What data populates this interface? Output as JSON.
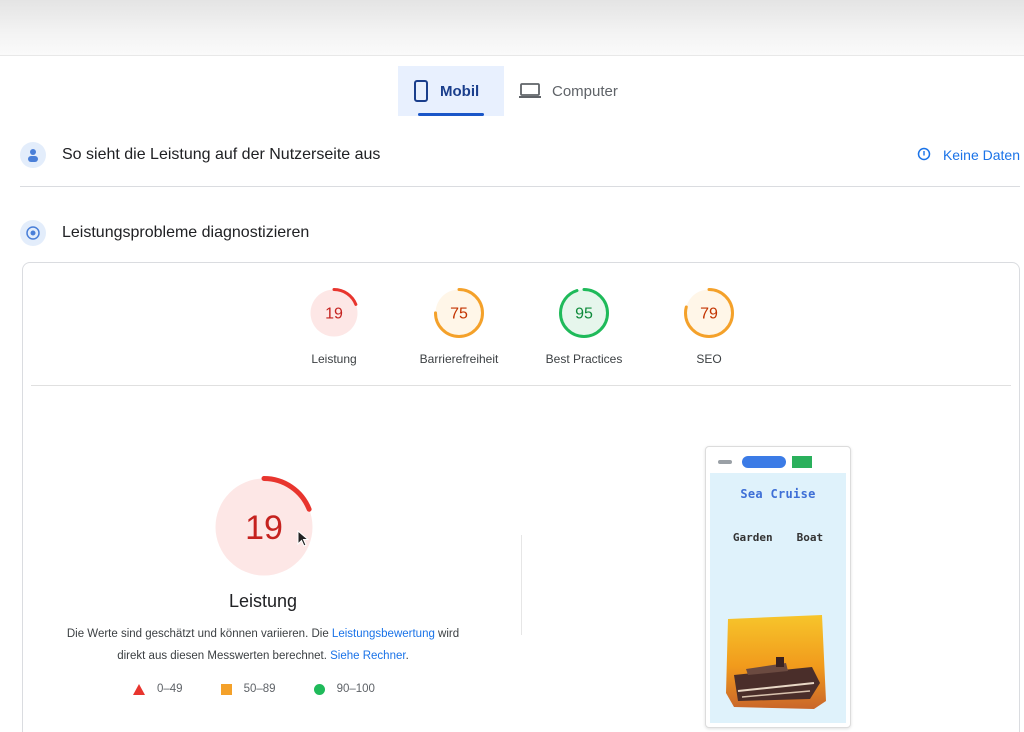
{
  "tabs": [
    {
      "label": "Mobil",
      "active": true
    },
    {
      "label": "Computer",
      "active": false
    }
  ],
  "field_section": {
    "title": "So sieht die Leistung auf der Nutzerseite aus",
    "status": "Keine Daten"
  },
  "lab_section": {
    "title": "Leistungsprobleme diagnostizieren"
  },
  "scores": [
    {
      "label": "Leistung",
      "value": "19",
      "fraction": 0.19,
      "color": "#e8352e",
      "bg": "#fde7e6",
      "text_color": "#c5221f"
    },
    {
      "label": "Barrierefreiheit",
      "value": "75",
      "fraction": 0.75,
      "color": "#f4a12a",
      "bg": "#fff6e8",
      "text_color": "#c33300"
    },
    {
      "label": "Best Practices",
      "value": "95",
      "fraction": 0.95,
      "color": "#1fba5a",
      "bg": "#e6f6ec",
      "text_color": "#0d8a3a"
    },
    {
      "label": "SEO",
      "value": "79",
      "fraction": 0.79,
      "color": "#f4a12a",
      "bg": "#fff6e8",
      "text_color": "#c33300"
    }
  ],
  "main_score": {
    "value": "19",
    "label": "Leistung",
    "fraction": 0.19
  },
  "description": {
    "part1": "Die Werte sind geschätzt und können variieren. Die ",
    "link1": "Leistungsbewertung",
    "part2": " wird direkt aus diesen Messwerten berechnet. ",
    "link2": "Siehe Rechner",
    "part3": "."
  },
  "legend": [
    {
      "shape": "triangle",
      "range": "0–49"
    },
    {
      "shape": "square",
      "range": "50–89"
    },
    {
      "shape": "circle",
      "range": "90–100"
    }
  ],
  "preview": {
    "site_title": "Sea Cruise",
    "nav": [
      "Garden",
      "Boat"
    ]
  }
}
